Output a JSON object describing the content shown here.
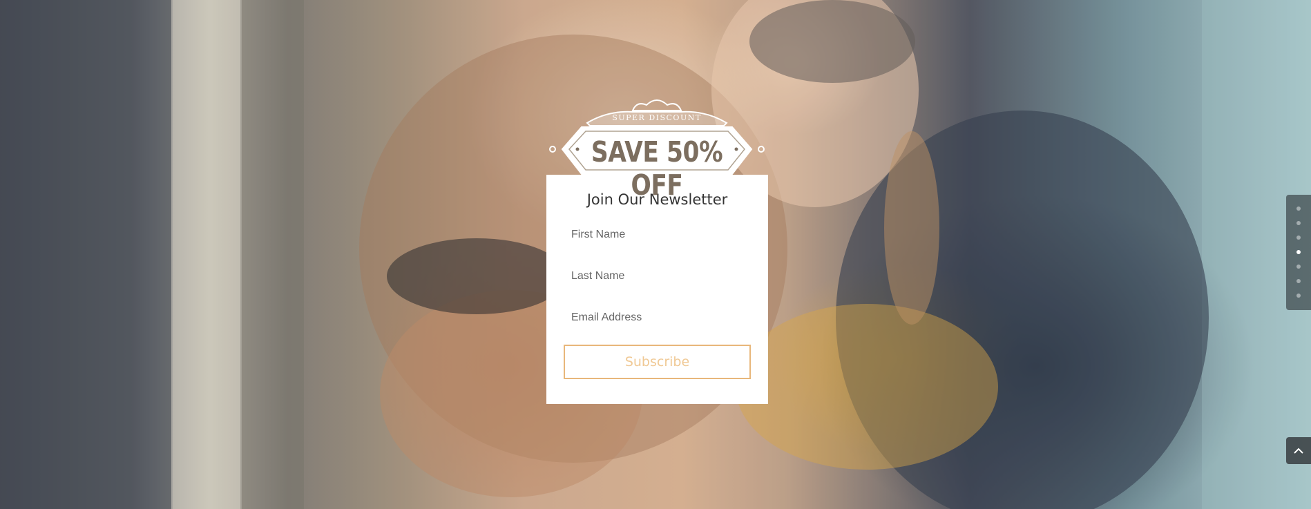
{
  "badge": {
    "top_text": "Super Discount",
    "main_text": "SAVE 50% OFF"
  },
  "newsletter": {
    "title": "Join Our Newsletter",
    "first_name_placeholder": "First Name",
    "last_name_placeholder": "Last Name",
    "email_placeholder": "Email Address",
    "subscribe_label": "Subscribe"
  },
  "dot_nav": {
    "count": 7,
    "active_index": 3
  },
  "colors": {
    "accent": "#e8b77a",
    "panel_bg": "#ffffff"
  },
  "icons": {
    "back_to_top": "chevron-up-icon"
  }
}
